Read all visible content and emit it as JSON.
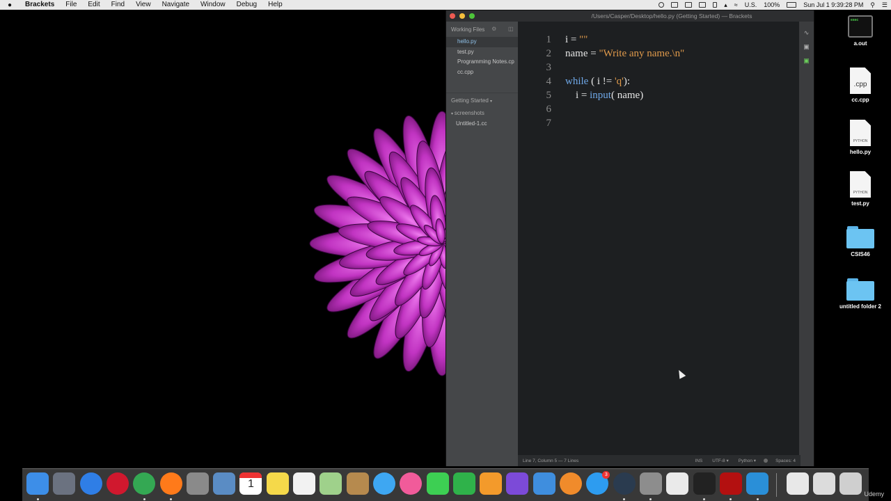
{
  "menubar": {
    "apple": "",
    "items": [
      "Brackets",
      "File",
      "Edit",
      "Find",
      "View",
      "Navigate",
      "Window",
      "Debug",
      "Help"
    ],
    "status": {
      "input_source": "U.S.",
      "battery": "100%",
      "clock": "Sun Jul 1  9:39:28 PM"
    }
  },
  "window": {
    "title": "/Users/Casper/Desktop/hello.py (Getting Started) — Brackets",
    "sidebar": {
      "working_files_label": "Working Files",
      "working_files": [
        {
          "name": "hello.py",
          "active": true
        },
        {
          "name": "test.py"
        },
        {
          "name": "Programming Notes.cp"
        },
        {
          "name": "cc.cpp"
        }
      ],
      "project_label": "Getting Started",
      "folder": "screenshots",
      "file": "Untitled-1.cc"
    },
    "editor": {
      "lines": [
        {
          "n": "1",
          "parts": [
            [
              "plain",
              "i = "
            ],
            [
              "str",
              "\"\""
            ]
          ]
        },
        {
          "n": "2",
          "parts": [
            [
              "plain",
              "name = "
            ],
            [
              "str",
              "\"Write any name.\\n\""
            ]
          ]
        },
        {
          "n": "3",
          "parts": []
        },
        {
          "n": "4",
          "parts": [
            [
              "kw",
              "while"
            ],
            [
              "plain",
              " ( i != "
            ],
            [
              "str",
              "'q'"
            ],
            [
              "plain",
              "):"
            ]
          ]
        },
        {
          "n": "5",
          "parts": [
            [
              "plain",
              "    i = "
            ],
            [
              "kw",
              "input"
            ],
            [
              "plain",
              "( name)"
            ]
          ]
        },
        {
          "n": "6",
          "parts": []
        },
        {
          "n": "7",
          "parts": []
        }
      ]
    },
    "status": {
      "position": "Line 7, Column 5 — 7 Lines",
      "mode": "INS",
      "encoding": "UTF-8",
      "language": "Python",
      "indent": "Spaces: 4"
    }
  },
  "desktop_icons": [
    {
      "label": "a.out",
      "kind": "exec",
      "glyph": "exec"
    },
    {
      "label": "cc.cpp",
      "kind": "doc",
      "ext": ".cpp"
    },
    {
      "label": "hello.py",
      "kind": "doc",
      "ext": "PYTHON"
    },
    {
      "label": "test.py",
      "kind": "doc",
      "ext": "PYTHON"
    },
    {
      "label": "CSIS46",
      "kind": "folder"
    },
    {
      "label": "untitled folder 2",
      "kind": "folder"
    }
  ],
  "dock": {
    "items": [
      {
        "name": "finder",
        "color": "#3d8ee8"
      },
      {
        "name": "launchpad",
        "color": "#6b7280"
      },
      {
        "name": "safari",
        "color": "#2f7ee6"
      },
      {
        "name": "opera",
        "color": "#d0182e"
      },
      {
        "name": "chrome",
        "color": "#34a853"
      },
      {
        "name": "firefox",
        "color": "#ff7a1a"
      },
      {
        "name": "calculator",
        "color": "#8a8a8a"
      },
      {
        "name": "preview",
        "color": "#5a8cc4"
      },
      {
        "name": "calendar",
        "color": "#ffffff",
        "text": "1"
      },
      {
        "name": "notes",
        "color": "#f5d94a"
      },
      {
        "name": "reminders",
        "color": "#f2f2f2"
      },
      {
        "name": "maps",
        "color": "#9fd18b"
      },
      {
        "name": "contacts",
        "color": "#b68a4e"
      },
      {
        "name": "messages",
        "color": "#3ea7f2"
      },
      {
        "name": "itunes",
        "color": "#f15b9a"
      },
      {
        "name": "facetime",
        "color": "#3dcf53"
      },
      {
        "name": "numbers",
        "color": "#2fb24a"
      },
      {
        "name": "pages",
        "color": "#f39a2b"
      },
      {
        "name": "imovie",
        "color": "#7c4ad8"
      },
      {
        "name": "keynote",
        "color": "#3f8ede"
      },
      {
        "name": "ibooks",
        "color": "#f08b2b"
      },
      {
        "name": "app-store",
        "color": "#2d9cf0",
        "badge": "3"
      },
      {
        "name": "quicktime",
        "color": "#2a3b4f"
      },
      {
        "name": "system-preferences",
        "color": "#8d8d8d"
      },
      {
        "name": "textedit",
        "color": "#eaeaea"
      },
      {
        "name": "terminal",
        "color": "#222222"
      },
      {
        "name": "acrobat",
        "color": "#b31010"
      },
      {
        "name": "brackets",
        "color": "#2a8fd8"
      }
    ],
    "right_items": [
      {
        "name": "documents-stack",
        "color": "#e8e8e8"
      },
      {
        "name": "downloads-stack",
        "color": "#dcdcdc"
      },
      {
        "name": "trash",
        "color": "#cfcfcf"
      }
    ]
  },
  "watermark": "Udemy"
}
